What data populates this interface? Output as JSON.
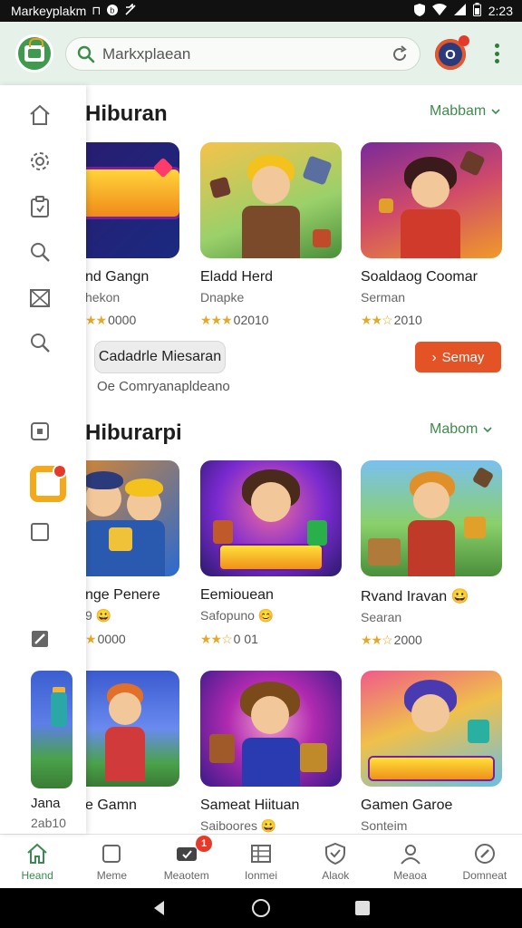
{
  "status_bar": {
    "app_name": "Markeyplakm",
    "notif_glyph": "⊓",
    "time": "2:23",
    "icons": [
      "b-icon",
      "no-sound-icon",
      "shield-icon",
      "wifi-icon",
      "signal-icon",
      "battery-icon"
    ]
  },
  "app_bar": {
    "search_placeholder": "Markxplaean",
    "avatar_letter": "O",
    "colors": {
      "bar_bg": "#e6f2e9",
      "accent": "#3f9a4f",
      "logo_arch": "#e9a21a"
    }
  },
  "side_rail": {
    "icons": [
      "home-icon",
      "settings-icon",
      "clipboard-icon",
      "search-icon",
      "image-frame-icon",
      "search-icon-2",
      "app-square-icon",
      "featured-app-icon",
      "empty-square-icon",
      "edit-icon"
    ],
    "partial_card_title": "Jana",
    "partial_card_sub": "2ab10"
  },
  "sections": [
    {
      "title": "Hiburan",
      "more_label": "Mabbam",
      "cards": [
        {
          "title": "nd Gangn",
          "sub": "hekon",
          "rating": "0000",
          "art": "title-art"
        },
        {
          "title": "Eladd Herd",
          "sub": "Dnapke",
          "rating": "02010",
          "art": "boy-blocks"
        },
        {
          "title": "Soaldaog Coomar",
          "sub": "Serman",
          "rating": "2010",
          "art": "cat-girl"
        }
      ],
      "pill_button": "Cadadrle Miesaran",
      "install_button": "Semay",
      "helper_text": "Oe Comryanapldeano"
    },
    {
      "title": "Hiburarpi",
      "more_label": "Mabom",
      "cards": [
        {
          "title": "nge Penere",
          "sub": "9 😀",
          "rating": "0000",
          "art": "two-boys"
        },
        {
          "title": "Eemiouean",
          "sub": "Safopuno 😊",
          "rating": "0 01",
          "art": "miveah"
        },
        {
          "title": "Rvand Iravan 😀",
          "sub": "Searan",
          "rating": "2000",
          "art": "forest-boy"
        }
      ]
    },
    {
      "cards": [
        {
          "title": "e Gamn",
          "sub": "",
          "rating": "",
          "art": "red-boy"
        },
        {
          "title": "Sameat Hiituan",
          "sub": "Saiboores 😀",
          "rating": "",
          "art": "cat-book"
        },
        {
          "title": "Gamen Garoe",
          "sub": "Sonteim",
          "rating": "",
          "art": "peuliaras"
        }
      ]
    }
  ],
  "bottom_nav": {
    "items": [
      {
        "label": "Heand",
        "icon": "home-icon",
        "active": true
      },
      {
        "label": "Meme",
        "icon": "square-icon",
        "active": false
      },
      {
        "label": "Meaotem",
        "icon": "gamepad-icon",
        "active": false
      },
      {
        "label": "Ionmei",
        "icon": "list-icon",
        "active": false
      },
      {
        "label": "Alaok",
        "icon": "shield-check-icon",
        "active": false
      },
      {
        "label": "Meaoa",
        "icon": "person-icon",
        "active": false
      },
      {
        "label": "Domneat",
        "icon": "compass-icon",
        "active": false
      }
    ],
    "badge": "1"
  },
  "system_nav": {
    "icons": [
      "back-icon",
      "home-circle-icon",
      "recents-icon"
    ]
  }
}
